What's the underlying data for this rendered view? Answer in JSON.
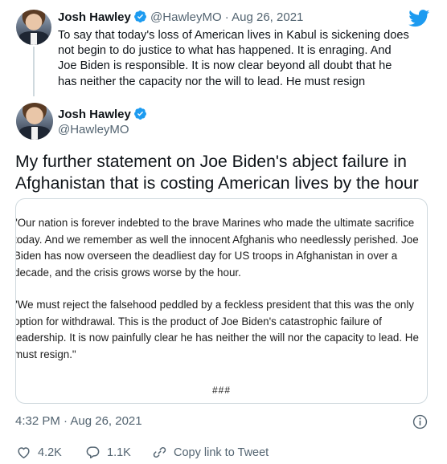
{
  "parent_tweet": {
    "display_name": "Josh Hawley",
    "handle": "@HawleyMO",
    "separator": "·",
    "date": "Aug 26, 2021",
    "text": "To say that today's loss of American lives in Kabul is sickening does not begin to do justice to what has happened. It is enraging. And Joe Biden is responsible. It is now clear beyond all doubt that he has neither the capacity nor the will to lead. He must resign"
  },
  "main_tweet": {
    "display_name": "Josh Hawley",
    "handle": "@HawleyMO",
    "text": "My further statement on Joe Biden's abject failure in Afghanistan that is costing American lives by the hour",
    "statement": {
      "paragraph_1": "\"Our nation is forever indebted to the brave Marines who made the ultimate sacrifice today. And we remember as well the innocent Afghanis who needlessly perished. Joe Biden has now overseen the deadliest day for US troops in Afghanistan in over a decade, and the crisis grows worse by the hour.",
      "paragraph_2": "\"We must reject the falsehood peddled by a feckless president that this was the only option for withdrawal. This is the product of Joe Biden's catastrophic failure of leadership. It is now painfully clear he has neither the will nor the capacity to lead. He must resign.\"",
      "closing": "###"
    },
    "timestamp": "4:32 PM · Aug 26, 2021"
  },
  "actions": {
    "like_count": "4.2K",
    "reply_count": "1.1K",
    "copy_link_label": "Copy link to Tweet"
  },
  "icons": {
    "verified": "verified-badge-icon",
    "brand": "twitter-bird-icon",
    "info": "info-icon",
    "like": "heart-icon",
    "reply": "reply-bubble-icon",
    "copy": "link-icon"
  },
  "colors": {
    "twitter_blue": "#1d9bf0",
    "text_primary": "#0f1419",
    "text_secondary": "#536471",
    "border": "#cfd9de"
  }
}
